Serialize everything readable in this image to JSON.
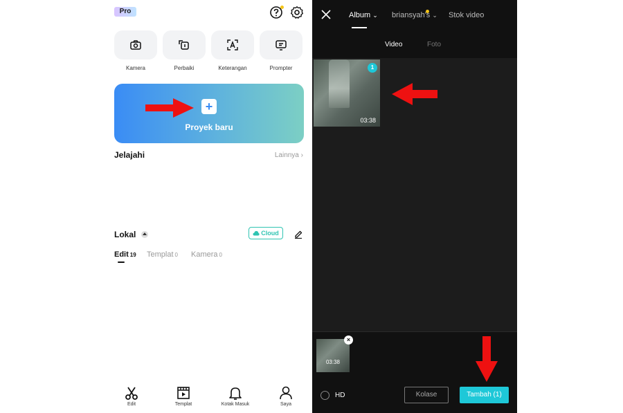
{
  "left": {
    "pro_badge": "Pro",
    "tools": [
      {
        "label": "Kamera",
        "icon": "camera-icon"
      },
      {
        "label": "Perbaiki",
        "icon": "repair-icon"
      },
      {
        "label": "Keterangan",
        "icon": "caption-icon"
      },
      {
        "label": "Prompter",
        "icon": "prompter-icon"
      }
    ],
    "new_project": {
      "label": "Proyek baru",
      "plus": "+"
    },
    "explore": {
      "title": "Jelajahi",
      "more": "Lainnya"
    },
    "local": {
      "title": "Lokal",
      "cloud": "Cloud"
    },
    "tabs": [
      {
        "label": "Edit",
        "count": "19"
      },
      {
        "label": "Templat",
        "count": "0"
      },
      {
        "label": "Kamera",
        "count": "0"
      }
    ],
    "nav": [
      {
        "label": "Edit",
        "icon": "scissors-icon"
      },
      {
        "label": "Templat",
        "icon": "template-icon"
      },
      {
        "label": "Kotak Masuk",
        "icon": "bell-icon"
      },
      {
        "label": "Saya",
        "icon": "profile-icon"
      }
    ]
  },
  "right": {
    "header": {
      "tabs": [
        {
          "label": "Album"
        },
        {
          "label": "briansyah's"
        },
        {
          "label": "Stok video"
        }
      ]
    },
    "subtabs": [
      {
        "label": "Video"
      },
      {
        "label": "Foto"
      }
    ],
    "media": {
      "duration": "03:38",
      "selection_index": "1"
    },
    "tray": {
      "duration": "03:38",
      "remove": "×"
    },
    "footer": {
      "hd_label": "HD",
      "kolase_label": "Kolase",
      "add_label": "Tambah (1)"
    }
  },
  "colors": {
    "accent": "#1ec8d8",
    "cloud": "#2fc4b2",
    "arrow": "#ee1111",
    "dark_bg": "#1c1c1c"
  }
}
